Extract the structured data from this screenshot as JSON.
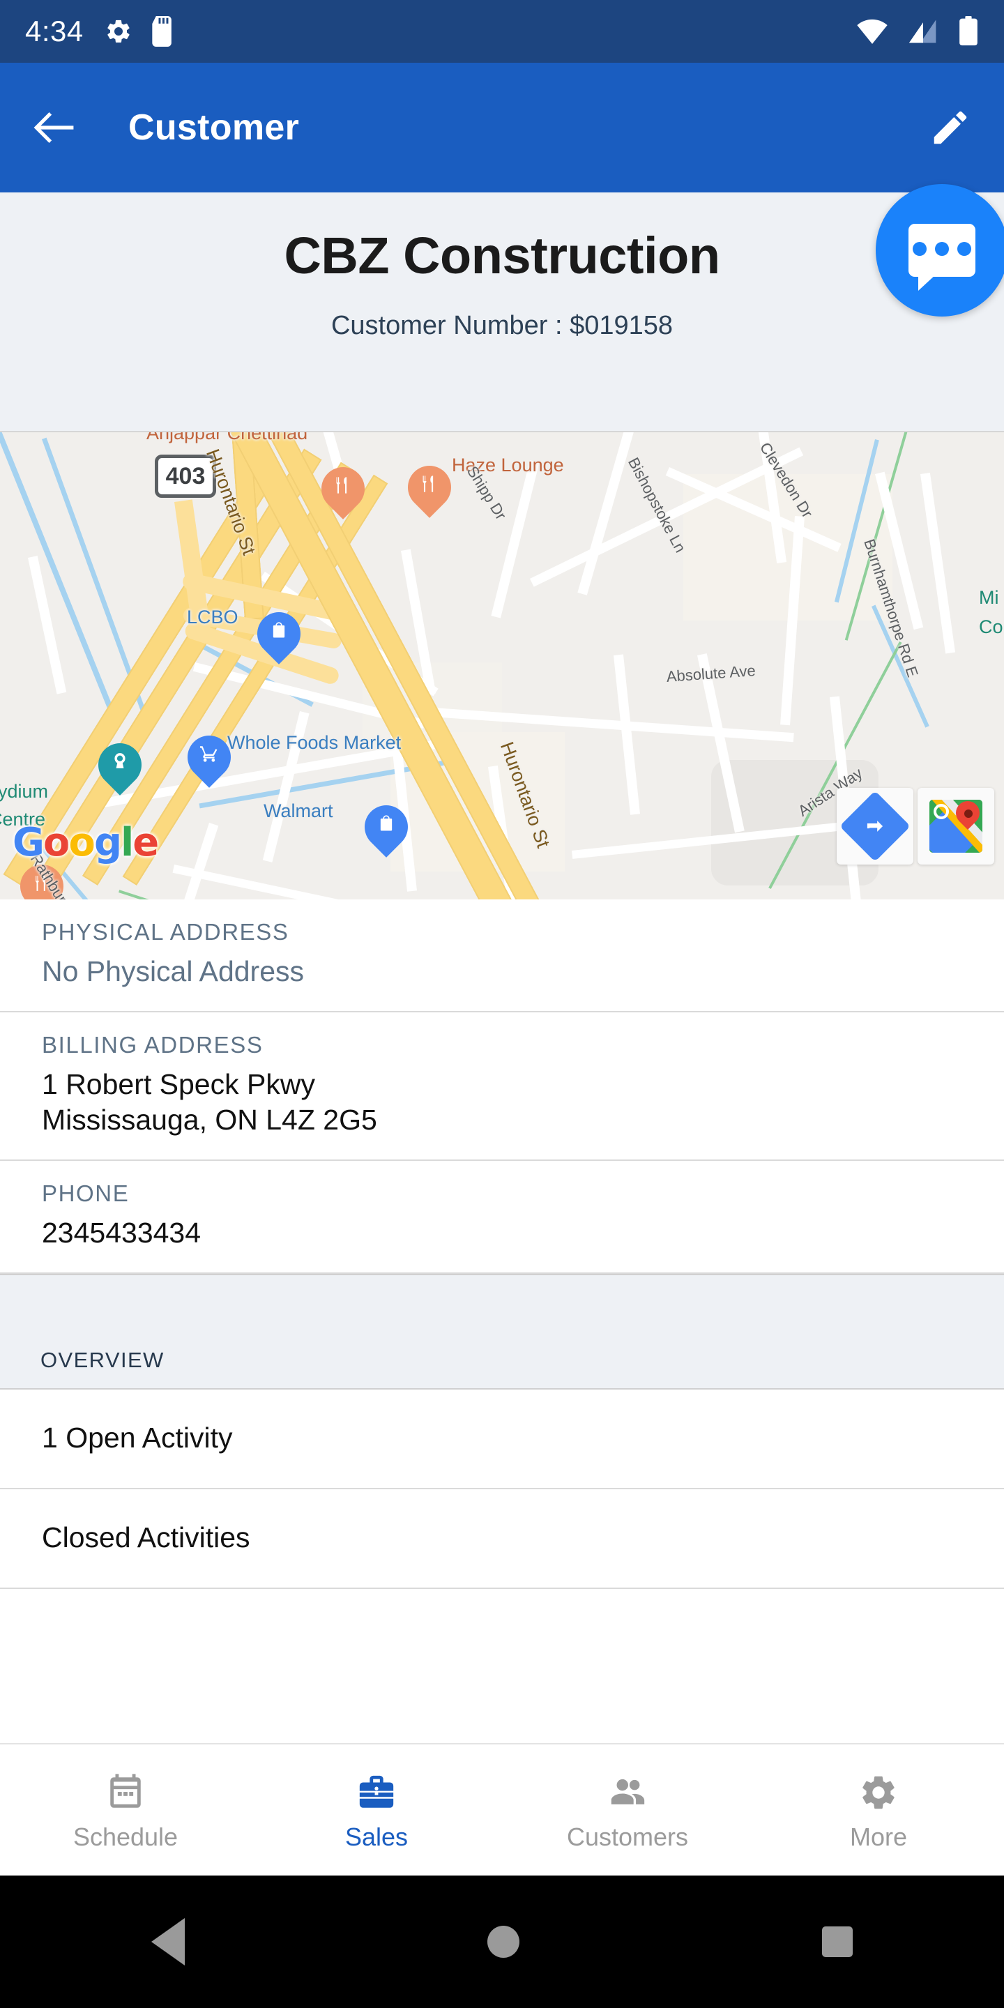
{
  "statusbar": {
    "time": "4:34",
    "icons": [
      "gear-icon",
      "sd-card-icon",
      "wifi-icon",
      "cellular-signal-icon",
      "battery-icon"
    ]
  },
  "appbar": {
    "back_label": "back-arrow",
    "title": "Customer",
    "edit_label": "edit-pencil"
  },
  "header": {
    "customer_name": "CBZ Construction",
    "customer_number": "Customer Number : $019158",
    "chat_button": "chat-bubble"
  },
  "map": {
    "attribution": "Google",
    "google_letters": [
      "G",
      "o",
      "o",
      "g",
      "l",
      "e"
    ],
    "highway_shield": "403",
    "labels": [
      "Anjappar Chettinad",
      "Haze Lounge",
      "Hurontario St",
      "Shipp Dr",
      "Bishopstoke Ln",
      "Clevedon Dr",
      "Burnhamthorpe Rd E",
      "LCBO",
      "Whole Foods Market",
      "Walmart",
      "Playdium",
      "Centre",
      "Rathburn Rd W",
      "Absolute Ave",
      "Arista Way",
      "Mi",
      "Co"
    ],
    "controls": [
      "directions-button",
      "open-google-maps-button"
    ],
    "pin_color": "#e8402a"
  },
  "details": [
    {
      "label": "PHYSICAL ADDRESS",
      "value": "No Physical Address",
      "muted": true
    },
    {
      "label": "BILLING ADDRESS",
      "line1": "1 Robert Speck Pkwy",
      "line2": "Mississauga, ON L4Z 2G5",
      "muted": false
    },
    {
      "label": "PHONE",
      "value": "2345433434",
      "muted": false
    }
  ],
  "overview": {
    "section_title": "OVERVIEW",
    "items": [
      {
        "label": "1 Open Activity"
      },
      {
        "label": "Closed Activities"
      }
    ]
  },
  "bottomnav": {
    "items": [
      {
        "label": "Schedule",
        "icon": "calendar-icon",
        "active": false
      },
      {
        "label": "Sales",
        "icon": "briefcase-icon",
        "active": true
      },
      {
        "label": "Customers",
        "icon": "people-icon",
        "active": false
      },
      {
        "label": "More",
        "icon": "gear-icon",
        "active": false
      }
    ],
    "active_color": "#1a5dc0",
    "inactive_color": "#9b9b9b"
  },
  "androidnav": {
    "buttons": [
      "back-triangle",
      "home-circle",
      "recents-square"
    ]
  }
}
